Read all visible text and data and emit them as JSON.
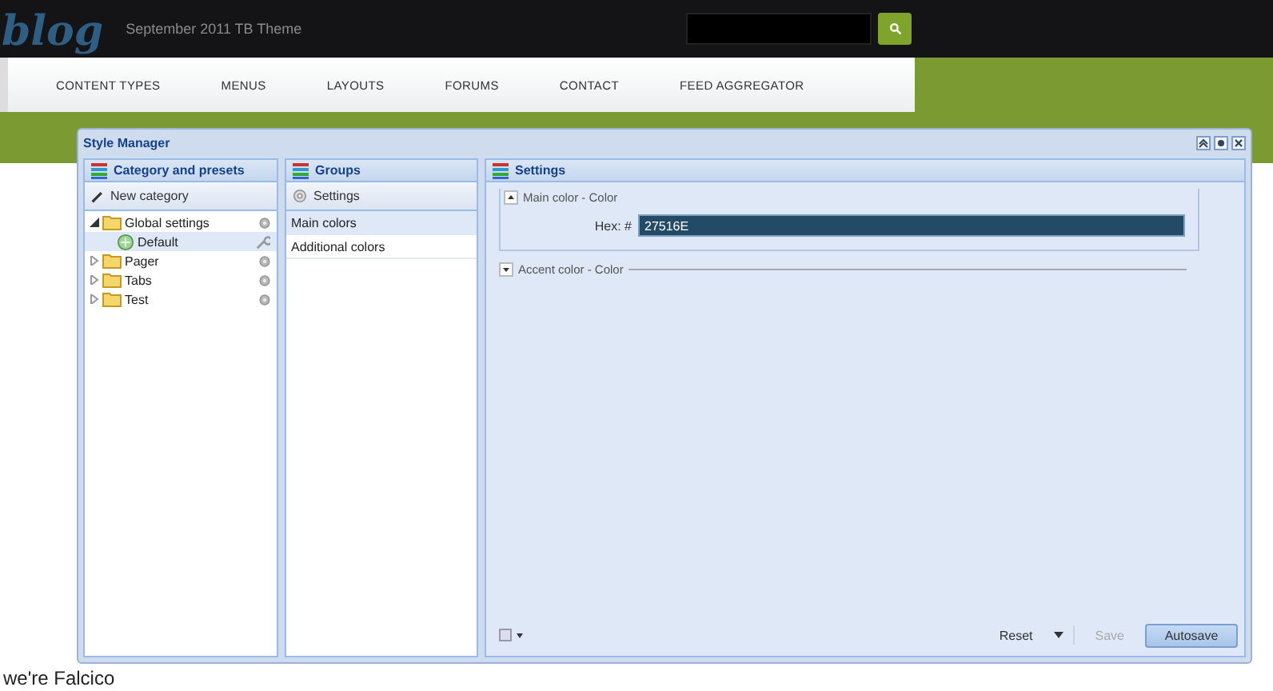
{
  "site": {
    "logo": "blog",
    "tagline": "September 2011 TB Theme",
    "nav": [
      "CONTENT TYPES",
      "MENUS",
      "LAYOUTS",
      "FORUMS",
      "CONTACT",
      "FEED AGGREGATOR"
    ],
    "intro": "we're Falcico"
  },
  "dialog": {
    "title": "Style Manager",
    "categories": {
      "title": "Category and presets",
      "new_button": "New category",
      "tree": [
        {
          "label": "Global settings",
          "kind": "category",
          "expanded": true,
          "selected": false,
          "children": [
            {
              "label": "Default",
              "kind": "preset",
              "selected": true
            }
          ]
        },
        {
          "label": "Pager",
          "kind": "category",
          "expanded": false,
          "selected": false
        },
        {
          "label": "Tabs",
          "kind": "category",
          "expanded": false,
          "selected": false
        },
        {
          "label": "Test",
          "kind": "category",
          "expanded": false,
          "selected": false
        }
      ]
    },
    "groups": {
      "title": "Groups",
      "settings_button": "Settings",
      "items": [
        {
          "label": "Main colors",
          "selected": true
        },
        {
          "label": "Additional colors",
          "selected": false
        }
      ]
    },
    "settings": {
      "title": "Settings",
      "fieldsets": [
        {
          "legend": "Main color - Color",
          "expanded": true,
          "field_label": "Hex: #",
          "value": "27516E"
        },
        {
          "legend": "Accent color - Color",
          "expanded": false
        }
      ]
    },
    "footer": {
      "reset": "Reset",
      "save": "Save",
      "save_disabled": true,
      "autosave": "Autosave",
      "autosave_pressed": true
    }
  }
}
